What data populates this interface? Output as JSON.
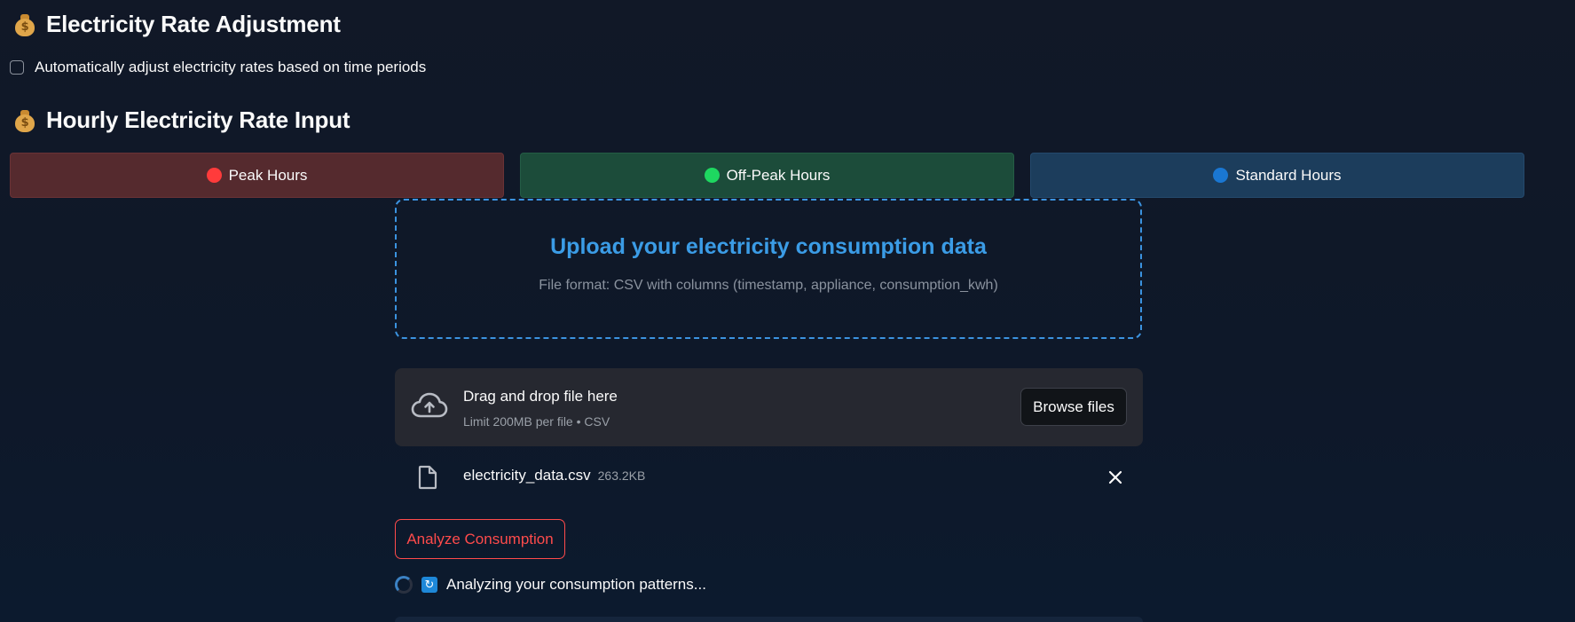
{
  "rate_adjustment": {
    "title": "Electricity Rate Adjustment",
    "icon": "money-bag-icon",
    "checkbox_label": "Automatically adjust electricity rates based on time periods",
    "checked": false
  },
  "hourly_input": {
    "title": "Hourly Electricity Rate Input",
    "icon": "money-bag-icon",
    "periods": [
      {
        "label": "Peak Hours",
        "dot_color": "#ff3b3b",
        "bg": "#552a2e"
      },
      {
        "label": "Off-Peak Hours",
        "dot_color": "#1ed760",
        "bg": "#1c4c3a"
      },
      {
        "label": "Standard Hours",
        "dot_color": "#1a77d2",
        "bg": "#1c3d5c"
      }
    ]
  },
  "upload_banner": {
    "title": "Upload your electricity consumption data",
    "subtitle": "File format: CSV with columns (timestamp, appliance, consumption_kwh)",
    "accent": "#3b9ce6"
  },
  "file_uploader": {
    "drop_label": "Drag and drop file here",
    "limit_label": "Limit 200MB per file • CSV",
    "browse_label": "Browse files"
  },
  "uploaded_file": {
    "name": "electricity_data.csv",
    "size": "263.2KB"
  },
  "analyze_button": {
    "label": "Analyze Consumption",
    "color": "#ff4b4b"
  },
  "status": {
    "icon": "refresh-icon",
    "text": "Analyzing your consumption patterns..."
  }
}
